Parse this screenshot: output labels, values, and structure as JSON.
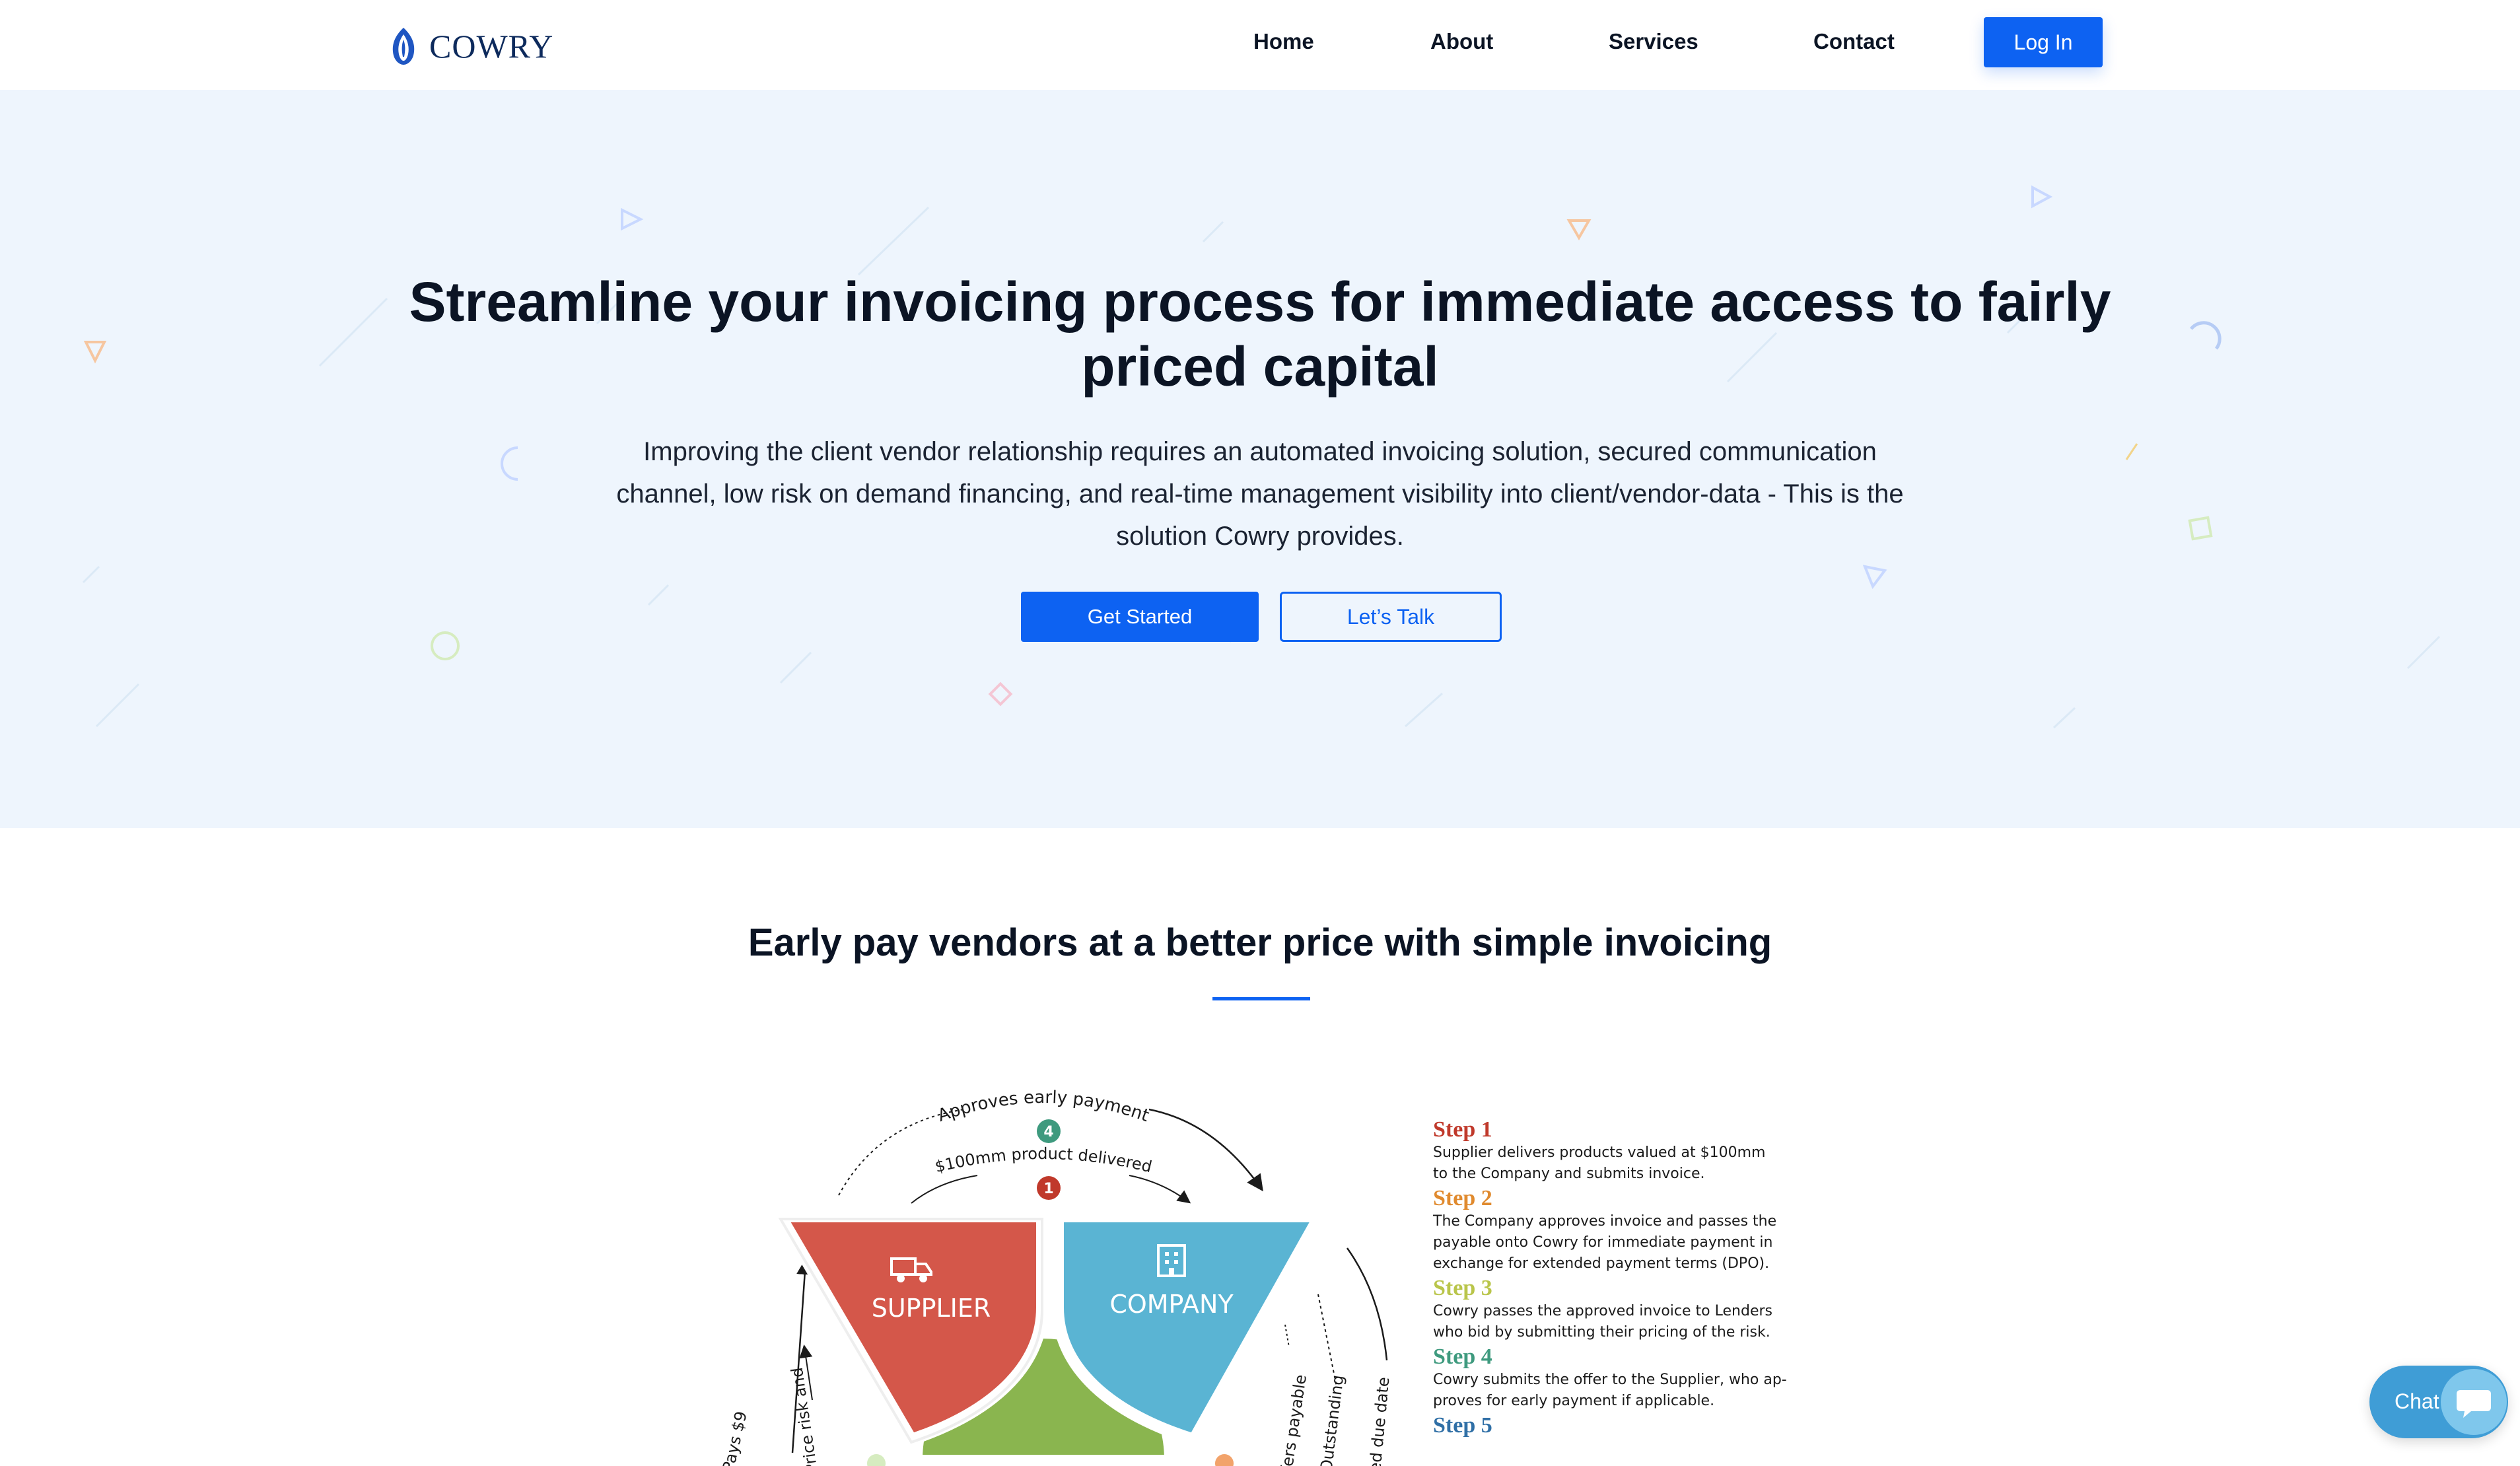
{
  "brand": {
    "name": "COWRY",
    "primary_color": "#0d62f2",
    "hero_bg": "#eef5fd"
  },
  "nav": {
    "items": [
      {
        "label": "Home"
      },
      {
        "label": "About"
      },
      {
        "label": "Services"
      },
      {
        "label": "Contact"
      }
    ],
    "login_label": "Log In"
  },
  "hero": {
    "title": "Streamline your invoicing process for immediate access to fairly priced capital",
    "subtitle": "Improving the client vendor relationship requires an automated invoicing solution, secured communication channel, low risk on demand financing, and real-time management visibility into client/vendor-data - This is the solution Cowry provides.",
    "primary_cta": "Get Started",
    "secondary_cta": "Let’s Talk"
  },
  "section": {
    "title": "Early pay vendors at a better price with simple invoicing"
  },
  "diagram": {
    "supplier_label": "SUPPLIER",
    "company_label": "COMPANY",
    "arc_top": "Approves early payment",
    "arc_inner": "$100mm product delivered",
    "badge_1": "1",
    "badge_4": "4",
    "left_outer": "Pays $9",
    "left_inner": "Price risk and",
    "right_inner": "fers payable",
    "right_mid": "Outstanding",
    "right_outer": "ed due date",
    "colors": {
      "supplier": "#d4574a",
      "company": "#5ab4d3",
      "bottom": "#8ab54f"
    }
  },
  "steps": [
    {
      "title": "Step 1",
      "color": "#c0392b",
      "lines": [
        "Supplier delivers products valued at $100mm",
        "to the Company and submits invoice."
      ]
    },
    {
      "title": "Step 2",
      "color": "#e08a2e",
      "lines": [
        "The Company approves invoice and passes the",
        "payable onto Cowry for immediate payment in",
        "exchange for extended payment terms (DPO)."
      ]
    },
    {
      "title": "Step 3",
      "color": "#b9c54a",
      "lines": [
        "Cowry passes the approved invoice to Lenders",
        "who bid by submitting their pricing of the risk."
      ]
    },
    {
      "title": "Step 4",
      "color": "#3e9a7e",
      "lines": [
        "Cowry submits the offer to the Supplier, who ap-",
        "proves for early payment if applicable."
      ]
    },
    {
      "title": "Step 5",
      "color": "#2f6fa6",
      "lines": []
    }
  ],
  "chat": {
    "label": "Chat"
  }
}
